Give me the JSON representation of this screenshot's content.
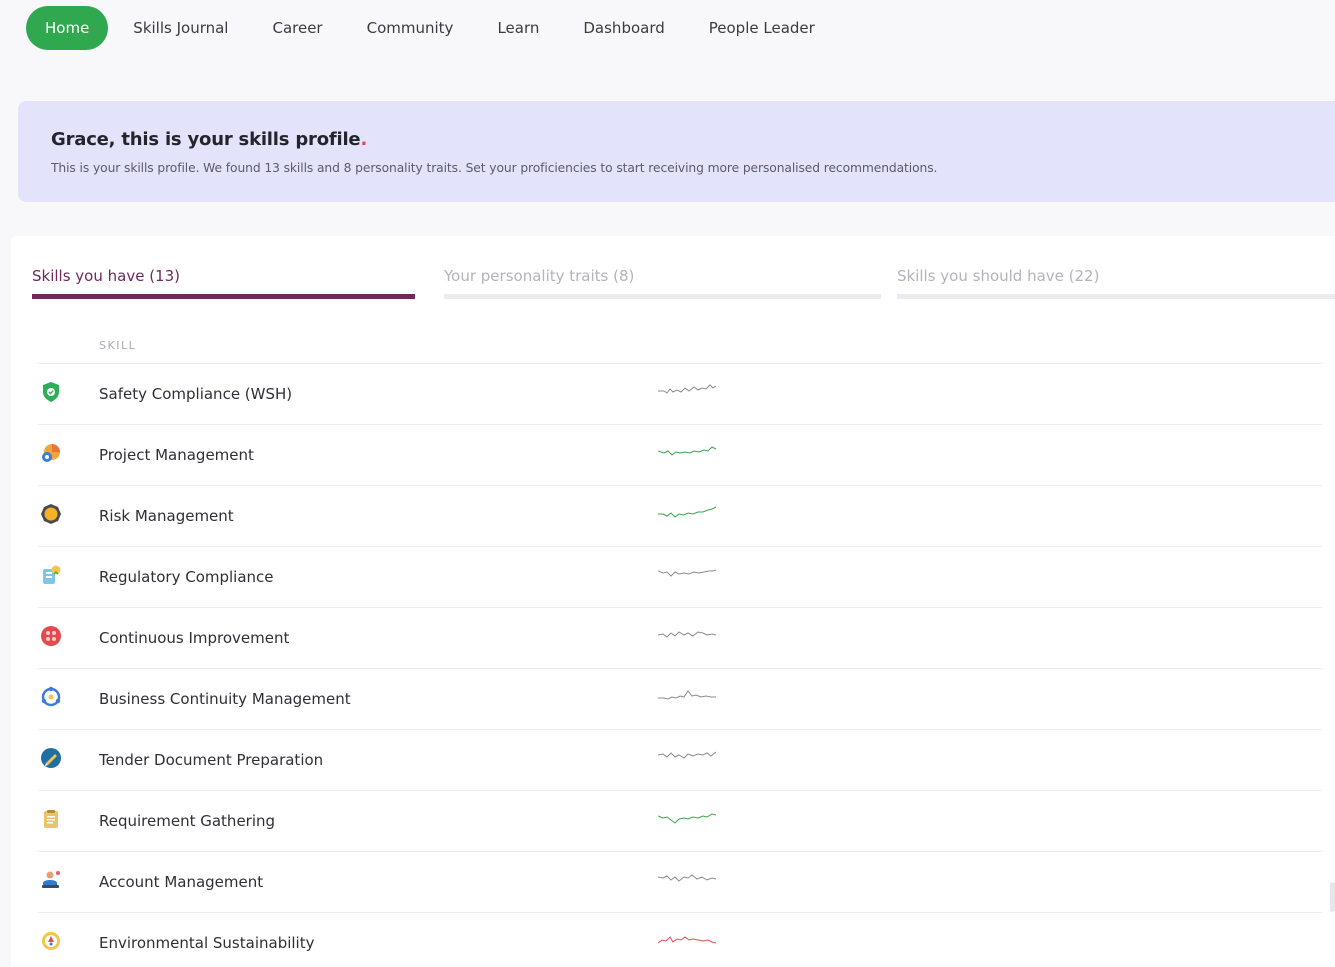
{
  "nav": {
    "items": [
      {
        "label": "Home",
        "active": true
      },
      {
        "label": "Skills Journal"
      },
      {
        "label": "Career"
      },
      {
        "label": "Community"
      },
      {
        "label": "Learn"
      },
      {
        "label": "Dashboard"
      },
      {
        "label": "People Leader"
      }
    ]
  },
  "banner": {
    "title": "Grace, this is your skills profile",
    "title_dot": ".",
    "subtitle": "This is your skills profile. We found 13 skills and 8 personality traits. Set your proficiencies to start receiving more personalised recommendations."
  },
  "tabs": [
    {
      "label": "Skills you have (13)",
      "active": true
    },
    {
      "label": "Your personality traits (8)"
    },
    {
      "label": "Skills you should have (22)"
    }
  ],
  "table": {
    "header": "SKILL",
    "rows": [
      {
        "label": "Safety Compliance (WSH)",
        "icon": "shield-icon",
        "trend": "gray"
      },
      {
        "label": "Project Management",
        "icon": "project-icon",
        "trend": "green"
      },
      {
        "label": "Risk Management",
        "icon": "risk-icon",
        "trend": "green"
      },
      {
        "label": "Regulatory Compliance",
        "icon": "compliance-icon",
        "trend": "gray"
      },
      {
        "label": "Continuous Improvement",
        "icon": "improvement-icon",
        "trend": "gray"
      },
      {
        "label": "Business Continuity Management",
        "icon": "continuity-icon",
        "trend": "gray"
      },
      {
        "label": "Tender Document Preparation",
        "icon": "tender-icon",
        "trend": "gray"
      },
      {
        "label": "Requirement Gathering",
        "icon": "clipboard-icon",
        "trend": "green"
      },
      {
        "label": "Account Management",
        "icon": "account-icon",
        "trend": "gray"
      },
      {
        "label": "Environmental Sustainability",
        "icon": "sustainability-icon",
        "trend": "red"
      }
    ]
  },
  "colors": {
    "accent_green": "#2fa84f",
    "tab_active": "#6e2a5e",
    "banner_bg": "#e3e3fb",
    "trend_green": "#3aa54a",
    "trend_gray": "#8a8a94",
    "trend_red": "#d9534f"
  }
}
